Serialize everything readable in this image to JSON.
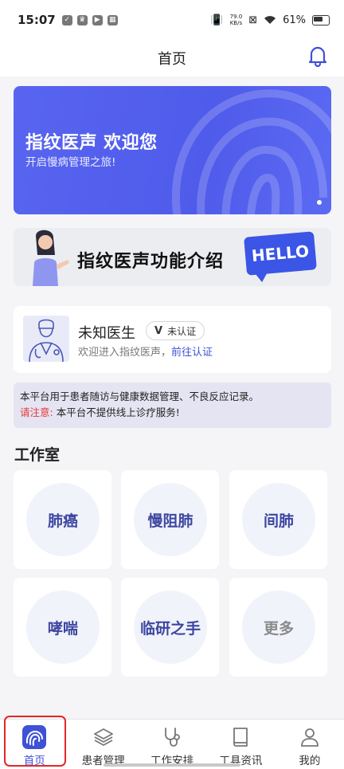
{
  "status_bar": {
    "time": "15:07",
    "net_speed_value": "79.0",
    "net_speed_unit": "KB/s",
    "battery": "61%"
  },
  "header": {
    "title": "首页",
    "bell_icon": "bell-icon"
  },
  "banner": {
    "title": "指纹医声 欢迎您",
    "subtitle": "开启慢病管理之旅!"
  },
  "intro_card": {
    "title": "指纹医声功能介绍",
    "badge": "HELLO"
  },
  "profile": {
    "name": "未知医生",
    "verify_mark": "V",
    "verify_status": "未认证",
    "welcome": "欢迎进入指纹医声，",
    "verify_link": "前往认证"
  },
  "notice": {
    "line1": "本平台用于患者随访与健康数据管理、不良反应记录。",
    "warn_label": "请注意:",
    "warn_text": "本平台不提供线上诊疗服务!"
  },
  "studio": {
    "title": "工作室",
    "items": [
      {
        "label": "肺癌"
      },
      {
        "label": "慢阻肺"
      },
      {
        "label": "间肺"
      },
      {
        "label": "哮喘"
      },
      {
        "label": "临研之手"
      },
      {
        "label": "更多"
      }
    ]
  },
  "tabs": [
    {
      "label": "首页",
      "icon": "home-fingerprint-icon",
      "active": true
    },
    {
      "label": "患者管理",
      "icon": "layers-icon",
      "active": false
    },
    {
      "label": "工作安排",
      "icon": "stethoscope-icon",
      "active": false
    },
    {
      "label": "工具资讯",
      "icon": "book-icon",
      "active": false
    },
    {
      "label": "我的",
      "icon": "user-icon",
      "active": false
    }
  ],
  "colors": {
    "accent": "#3f51d6",
    "banner": "#5865f0",
    "warning": "#e53935",
    "highlight_box": "#e32727"
  }
}
